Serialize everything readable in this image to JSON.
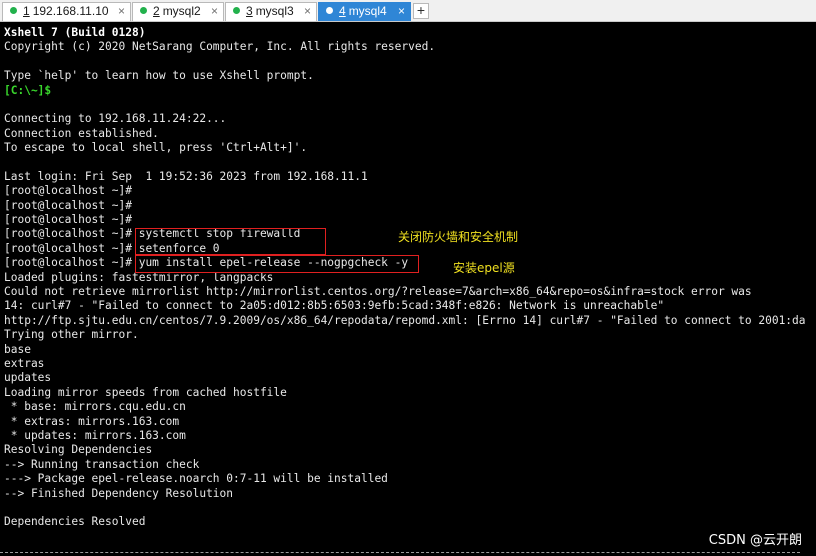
{
  "tabs": [
    {
      "number": "1",
      "label": "192.168.11.10",
      "close": "×"
    },
    {
      "number": "2",
      "label": "mysql2",
      "close": "×"
    },
    {
      "number": "3",
      "label": "mysql3",
      "close": "×"
    },
    {
      "number": "4",
      "label": "mysql4",
      "close": "×"
    }
  ],
  "add_tab_label": "+",
  "terminal": {
    "lines": [
      "Xshell 7 (Build 0128)",
      "Copyright (c) 2020 NetSarang Computer, Inc. All rights reserved.",
      "",
      "Type `help' to learn how to use Xshell prompt.",
      "[C:\\~]$",
      "",
      "Connecting to 192.168.11.24:22...",
      "Connection established.",
      "To escape to local shell, press 'Ctrl+Alt+]'.",
      "",
      "Last login: Fri Sep  1 19:52:36 2023 from 192.168.11.1",
      "[root@localhost ~]#",
      "[root@localhost ~]#",
      "[root@localhost ~]#",
      "[root@localhost ~]# systemctl stop firewalld",
      "[root@localhost ~]# setenforce 0",
      "[root@localhost ~]# yum install epel-release --nogpgcheck -y",
      "Loaded plugins: fastestmirror, langpacks",
      "Could not retrieve mirrorlist http://mirrorlist.centos.org/?release=7&arch=x86_64&repo=os&infra=stock error was",
      "14: curl#7 - \"Failed to connect to 2a05:d012:8b5:6503:9efb:5cad:348f:e826: Network is unreachable\"",
      "http://ftp.sjtu.edu.cn/centos/7.9.2009/os/x86_64/repodata/repomd.xml: [Errno 14] curl#7 - \"Failed to connect to 2001:da",
      "Trying other mirror.",
      "base",
      "extras",
      "updates",
      "Loading mirror speeds from cached hostfile",
      " * base: mirrors.cqu.edu.cn",
      " * extras: mirrors.163.com",
      " * updates: mirrors.163.com",
      "Resolving Dependencies",
      "--> Running transaction check",
      "---> Package epel-release.noarch 0:7-11 will be installed",
      "--> Finished Dependency Resolution",
      "",
      "Dependencies Resolved",
      ""
    ]
  },
  "annotations": {
    "firewall_note": "关闭防火墙和安全机制",
    "epel_note": "安装epel源"
  },
  "watermark": "CSDN @云开朗",
  "colors": {
    "background": "#000000",
    "text": "#e8e8e8",
    "prompt_green": "#39d62c",
    "highlight_red": "#e02020",
    "annotation_yellow": "#f0e020",
    "active_tab_blue": "#2f86d6",
    "session_dot_green": "#22b14c"
  }
}
